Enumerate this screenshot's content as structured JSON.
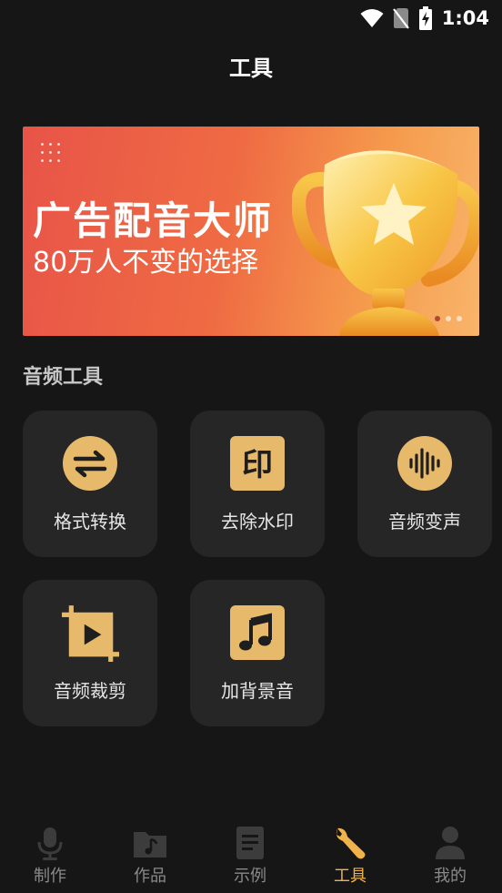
{
  "status_bar": {
    "time": "1:04"
  },
  "header": {
    "title": "工具"
  },
  "banner": {
    "title": "广告配音大师",
    "subtitle": "80万人不变的选择",
    "pages": 3,
    "active_page": 1
  },
  "section": {
    "title": "音频工具"
  },
  "tools": [
    {
      "label": "格式转换",
      "icon": "convert-icon"
    },
    {
      "label": "去除水印",
      "icon": "watermark-icon"
    },
    {
      "label": "音频变声",
      "icon": "voice-wave-icon"
    },
    {
      "label": "音频裁剪",
      "icon": "crop-icon"
    },
    {
      "label": "加背景音",
      "icon": "music-note-icon"
    }
  ],
  "tabs": [
    {
      "label": "制作",
      "icon": "microphone-icon"
    },
    {
      "label": "作品",
      "icon": "folder-music-icon"
    },
    {
      "label": "示例",
      "icon": "document-icon"
    },
    {
      "label": "工具",
      "icon": "wrench-icon",
      "active": true
    },
    {
      "label": "我的",
      "icon": "person-icon"
    }
  ],
  "colors": {
    "background": "#161616",
    "card": "#262626",
    "accent": "#f0b24a",
    "icon_fill": "#e7b96a"
  },
  "watermark_glyph": "印"
}
